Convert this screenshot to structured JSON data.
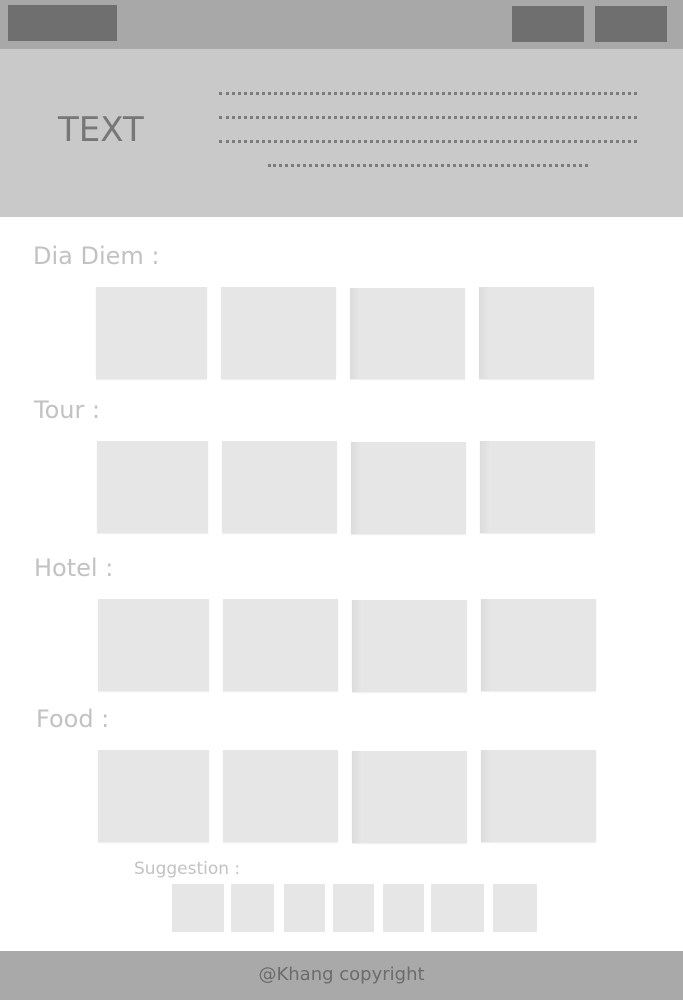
{
  "hero": {
    "title": "TEXT"
  },
  "sections": [
    {
      "label": "Dia Diem :"
    },
    {
      "label": "Tour :"
    },
    {
      "label": "Hotel :"
    },
    {
      "label": "Food :"
    }
  ],
  "suggestion": {
    "label": "Suggestion :"
  },
  "footer": {
    "copyright": "@Khang copyright"
  }
}
